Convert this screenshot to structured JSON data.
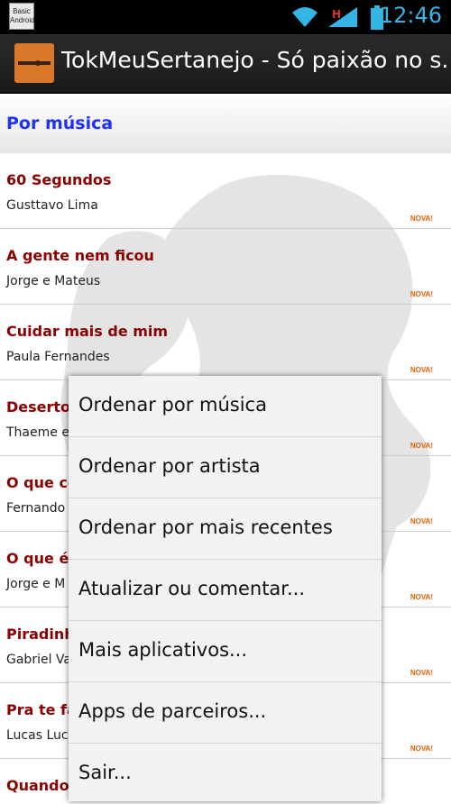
{
  "status_bar": {
    "notification_text": "Basic Android",
    "time": "12:46"
  },
  "action_bar": {
    "title": "TokMeuSertanejo - Só paixão no s..."
  },
  "section": {
    "title": "Por música"
  },
  "list": [
    {
      "song": "60 Segundos",
      "artist": "Gusttavo Lima",
      "badge": "NOVA!"
    },
    {
      "song": "A gente nem ficou",
      "artist": "Jorge e Mateus",
      "badge": "NOVA!"
    },
    {
      "song": "Cuidar mais de mim",
      "artist": "Paula Fernandes",
      "badge": "NOVA!"
    },
    {
      "song": "Deserto",
      "artist": "Thaeme e",
      "badge": "NOVA!"
    },
    {
      "song": "O que cê",
      "artist": "Fernando",
      "badge": "NOVA!"
    },
    {
      "song": "O que é",
      "artist": "Jorge e M",
      "badge": "NOVA!"
    },
    {
      "song": "Piradinh",
      "artist": "Gabriel Va",
      "badge": "NOVA!"
    },
    {
      "song": "Pra te fa",
      "artist": "Lucas Luc",
      "badge": "NOVA!"
    },
    {
      "song": "Quando",
      "artist": "",
      "badge": ""
    }
  ],
  "menu": [
    {
      "label": "Ordenar por música"
    },
    {
      "label": "Ordenar por artista"
    },
    {
      "label": "Ordenar por mais recentes"
    },
    {
      "label": "Atualizar ou comentar..."
    },
    {
      "label": "Mais aplicativos..."
    },
    {
      "label": "Apps de parceiros..."
    },
    {
      "label": "Sair..."
    }
  ],
  "colors": {
    "accent": "#33b5e5",
    "section_title": "#2030ff",
    "song_title": "#8b0000",
    "badge": "#e8600a"
  }
}
